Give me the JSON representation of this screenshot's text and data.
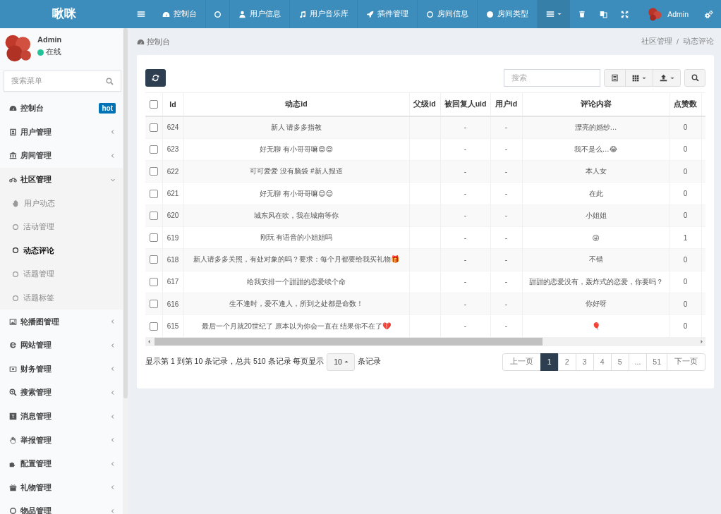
{
  "topbar": {
    "logo": "啾咪",
    "nav": [
      {
        "kind": "link",
        "label": "控制台"
      },
      {
        "kind": "icon"
      },
      {
        "kind": "link",
        "label": "用户信息"
      },
      {
        "kind": "link",
        "label": "用户音乐库"
      },
      {
        "kind": "link",
        "label": "插件管理"
      },
      {
        "kind": "link",
        "label": "房间信息"
      },
      {
        "kind": "link",
        "label": "房间类型"
      }
    ],
    "user": "Admin"
  },
  "sidebar": {
    "user": {
      "name": "Admin",
      "status": "在线"
    },
    "search": {
      "placeholder": "搜索菜单"
    },
    "menu": [
      {
        "kind": "link",
        "label": "控制台",
        "badge": "hot",
        "expanded": false
      },
      {
        "kind": "group",
        "label": "用户管理",
        "expanded": false
      },
      {
        "kind": "group",
        "label": "房间管理",
        "expanded": false
      },
      {
        "kind": "group",
        "label": "社区管理",
        "expanded": true,
        "children": [
          {
            "label": "用户动态",
            "selected": false
          },
          {
            "label": "活动管理",
            "selected": false
          },
          {
            "label": "动态评论",
            "selected": true
          },
          {
            "label": "话题管理",
            "selected": false
          },
          {
            "label": "话题标签",
            "selected": false
          }
        ]
      },
      {
        "kind": "group",
        "label": "轮播图管理",
        "expanded": false
      },
      {
        "kind": "group",
        "label": "网站管理",
        "expanded": false
      },
      {
        "kind": "group",
        "label": "财务管理",
        "expanded": false
      },
      {
        "kind": "group",
        "label": "搜索管理",
        "expanded": false
      },
      {
        "kind": "group",
        "label": "消息管理",
        "expanded": false
      },
      {
        "kind": "group",
        "label": "举报管理",
        "expanded": false
      },
      {
        "kind": "group",
        "label": "配置管理",
        "expanded": false
      },
      {
        "kind": "group",
        "label": "礼物管理",
        "expanded": false
      },
      {
        "kind": "group",
        "label": "物品管理",
        "expanded": false
      }
    ]
  },
  "content_header": {
    "title": "控制台",
    "breadcrumb": {
      "items": [
        "社区管理",
        "动态评论"
      ],
      "separator": "/"
    }
  },
  "toolbar": {
    "search": {
      "placeholder": "搜索"
    }
  },
  "table": {
    "header_checked": false,
    "columns": [
      "Id",
      "动态id",
      "父级id",
      "被回复人uid",
      "用户id",
      "评论内容",
      "点赞数"
    ],
    "rows": [
      {
        "checked": false,
        "id": "624",
        "dynamic": "新人 请多多指教",
        "reply_uid": "-",
        "user_id": "-",
        "comment": "漂亮的婚纱…",
        "likes": "0"
      },
      {
        "checked": false,
        "id": "623",
        "dynamic": "好无聊 有小哥哥嘛😌😌",
        "reply_uid": "-",
        "user_id": "-",
        "comment": "我不是么…😂",
        "likes": "0"
      },
      {
        "checked": false,
        "id": "622",
        "dynamic": "可可爱爱 没有脑袋 #新人报道",
        "reply_uid": "-",
        "user_id": "-",
        "comment": "本人女",
        "likes": "0"
      },
      {
        "checked": false,
        "id": "621",
        "dynamic": "好无聊 有小哥哥嘛😌😌",
        "reply_uid": "-",
        "user_id": "-",
        "comment": "在此",
        "likes": "0"
      },
      {
        "checked": false,
        "id": "620",
        "dynamic": "城东风在吹，我在城南等你",
        "reply_uid": "-",
        "user_id": "-",
        "comment": "小姐姐",
        "likes": "0"
      },
      {
        "checked": false,
        "id": "619",
        "dynamic": "刚玩 有语音的小姐姐吗",
        "reply_uid": "-",
        "user_id": "-",
        "comment": "😜",
        "likes": "1"
      },
      {
        "checked": false,
        "id": "618",
        "dynamic": "新人请多多关照，有处对象的吗？要求：每个月都要给我买礼物🎁",
        "reply_uid": "-",
        "user_id": "-",
        "comment": "不错",
        "likes": "0"
      },
      {
        "checked": false,
        "id": "617",
        "dynamic": "给我安排一个甜甜的恋爱续个命",
        "reply_uid": "-",
        "user_id": "-",
        "comment": "甜甜的恋爱没有，轰炸式的恋爱，你要吗？",
        "likes": "0"
      },
      {
        "checked": false,
        "id": "616",
        "dynamic": "生不逢时，爱不逢人，所到之处都是命数！",
        "reply_uid": "-",
        "user_id": "-",
        "comment": "你好呀",
        "likes": "0"
      },
      {
        "checked": false,
        "id": "615",
        "dynamic": "最后一个月就20世纪了 原本以为你会一直在 结果你不在了💔",
        "reply_uid": "-",
        "user_id": "-",
        "comment": "🎈",
        "likes": "0"
      }
    ]
  },
  "footer": {
    "info": "显示第 1 到第 10 条记录，总共 510 条记录 每页显示",
    "page_size": "10",
    "info_suffix": "条记录"
  },
  "pagination": {
    "pages": [
      {
        "label": "上一页",
        "selected": false
      },
      {
        "label": "1",
        "selected": true
      },
      {
        "label": "2",
        "selected": false
      },
      {
        "label": "3",
        "selected": false
      },
      {
        "label": "4",
        "selected": false
      },
      {
        "label": "5",
        "selected": false
      },
      {
        "label": "...",
        "selected": false
      },
      {
        "label": "51",
        "selected": false
      },
      {
        "label": "下一页",
        "selected": false
      }
    ]
  }
}
